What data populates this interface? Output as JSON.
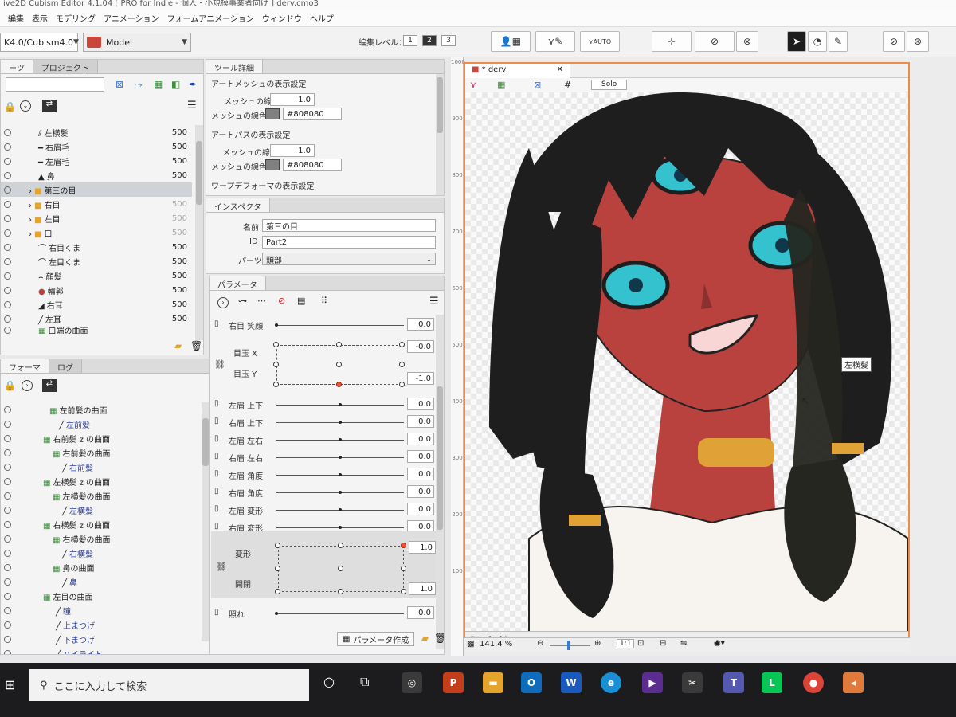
{
  "window": {
    "title": "ive2D Cubism Editor 4.1.04   [ PRO for Indie - 個人・小規模事業者向け ]   derv.cmo3"
  },
  "menu": [
    "編集",
    "表示",
    "モデリング",
    "アニメーション",
    "フォームアニメーション",
    "ウィンドウ",
    "ヘルプ"
  ],
  "toolbar": {
    "version_select": "K4.0/Cubism4.0",
    "mode_select": "Model",
    "edit_level_label": "編集レベル：",
    "edit_levels": [
      "1",
      "2",
      "3"
    ],
    "auto_label": "AUTO"
  },
  "parts_panel": {
    "tabs": [
      "ーツ",
      "プロジェクト"
    ],
    "items": [
      {
        "label": "左横髪",
        "value": "500"
      },
      {
        "label": "右眉毛",
        "value": "500"
      },
      {
        "label": "左眉毛",
        "value": "500"
      },
      {
        "label": "鼻",
        "value": "500"
      },
      {
        "label": "第三の目",
        "value": ""
      },
      {
        "label": "右目",
        "value": "500"
      },
      {
        "label": "左目",
        "value": "500"
      },
      {
        "label": "口",
        "value": "500"
      },
      {
        "label": "右目くま",
        "value": "500"
      },
      {
        "label": "左目くま",
        "value": "500"
      },
      {
        "label": "顔髪",
        "value": "500"
      },
      {
        "label": "輪郭",
        "value": "500"
      },
      {
        "label": "右耳",
        "value": "500"
      },
      {
        "label": "左耳",
        "value": "500"
      },
      {
        "label": "口端の曲面",
        "value": ""
      }
    ]
  },
  "deformer_panel": {
    "tabs": [
      "フォーマ",
      "ログ"
    ],
    "items": [
      {
        "label": "左前髪の曲面",
        "kind": "deform"
      },
      {
        "label": "左前髪",
        "kind": "art"
      },
      {
        "label": "右前髪 z の曲面",
        "kind": "deform"
      },
      {
        "label": "右前髪の曲面",
        "kind": "deform"
      },
      {
        "label": "右前髪",
        "kind": "art"
      },
      {
        "label": "左横髪 z の曲面",
        "kind": "deform"
      },
      {
        "label": "左横髪の曲面",
        "kind": "deform"
      },
      {
        "label": "左横髪",
        "kind": "art"
      },
      {
        "label": "右横髪 z の曲面",
        "kind": "deform"
      },
      {
        "label": "右横髪の曲面",
        "kind": "deform"
      },
      {
        "label": "右横髪",
        "kind": "art"
      },
      {
        "label": "鼻の曲面",
        "kind": "deform"
      },
      {
        "label": "鼻",
        "kind": "art"
      },
      {
        "label": "左目の曲面",
        "kind": "deform"
      },
      {
        "label": "瞳",
        "kind": "art"
      },
      {
        "label": "上まつげ",
        "kind": "art"
      },
      {
        "label": "下まつげ",
        "kind": "art"
      },
      {
        "label": "ハイライト",
        "kind": "art"
      }
    ]
  },
  "tool_details": {
    "tab": "ツール詳細",
    "art_mesh_header": "アートメッシュの表示設定",
    "mesh_width_label": "メッシュの線幅",
    "mesh_width_value": "1.0",
    "mesh_color_label": "メッシュの線色",
    "mesh_color_value": "#808080",
    "art_path_header": "アートパスの表示設定",
    "path_width_label": "メッシュの線幅",
    "path_width_value": "1.0",
    "path_color_label": "メッシュの線色",
    "path_color_value": "#808080",
    "warp_header": "ワープデフォーマの表示設定"
  },
  "inspector": {
    "tab": "インスペクタ",
    "name_label": "名前",
    "name_value": "第三の目",
    "id_label": "ID",
    "id_value": "Part2",
    "parts_label": "パーツ",
    "parts_value": "頭部"
  },
  "parameters": {
    "tab": "パラメータ",
    "rows": [
      {
        "label": "右目 笑顔",
        "value": "0.0"
      },
      {
        "label": "左眉 上下",
        "value": "0.0"
      },
      {
        "label": "右眉 上下",
        "value": "0.0"
      },
      {
        "label": "左眉 左右",
        "value": "0.0"
      },
      {
        "label": "右眉 左右",
        "value": "0.0"
      },
      {
        "label": "左眉 角度",
        "value": "0.0"
      },
      {
        "label": "右眉 角度",
        "value": "0.0"
      },
      {
        "label": "左眉 変形",
        "value": "0.0"
      },
      {
        "label": "右眉 変形",
        "value": "0.0"
      },
      {
        "label": "照れ",
        "value": "0.0"
      }
    ],
    "eyeball": {
      "label_x": "目玉 X",
      "label_y": "目玉 Y",
      "value_x": "-0.0",
      "value_y": "-1.0"
    },
    "mouth": {
      "label_form": "変形",
      "label_open": "開閉",
      "value_form": "1.0",
      "value_open": "1.0"
    },
    "create_button": "パラメータ作成"
  },
  "canvas": {
    "tab": "* derv",
    "solo_label": "Solo",
    "zoom": "141.4 %",
    "ratio_button": "1:1",
    "tooltip": "左横髪",
    "ruler_ticks": [
      "1000",
      "900",
      "800",
      "700",
      "600",
      "500",
      "400",
      "300",
      "200",
      "100"
    ]
  },
  "taskbar": {
    "search_placeholder": "ここに入力して検索"
  },
  "colors": {
    "skin": "#b9423f",
    "hair": "#1e1e1e",
    "eye": "#34c2cf",
    "accent_orange": "#f08a4b"
  }
}
